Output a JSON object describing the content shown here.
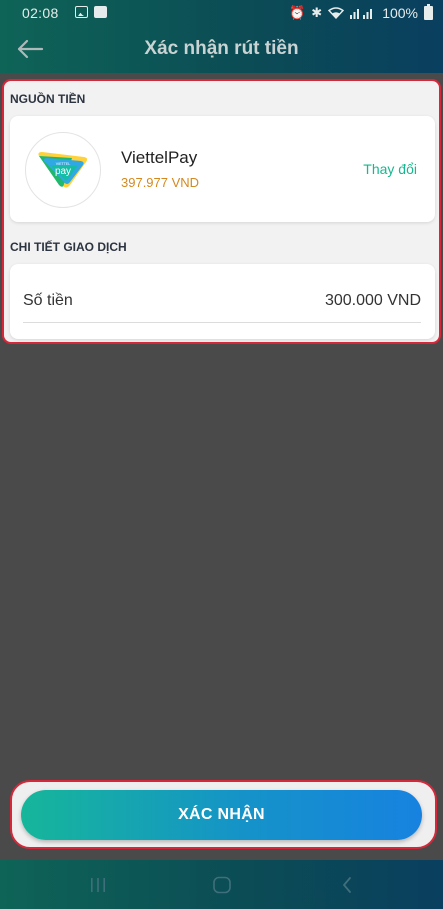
{
  "status_bar": {
    "time": "02:08",
    "battery": "100%",
    "icons": [
      "image-icon",
      "notification-icon",
      "alarm-icon",
      "bluetooth-icon",
      "wifi-icon",
      "signal-icon",
      "battery-icon"
    ]
  },
  "app_bar": {
    "back_icon": "arrow-left-icon",
    "title": "Xác nhận rút tiền"
  },
  "source_section": {
    "title": "NGUỒN TIỀN",
    "wallet_name": "ViettelPay",
    "balance": "397.977 VND",
    "change_label": "Thay đổi",
    "logo_icon": "viettelpay-logo-icon",
    "logo_text_small": "VIETTEL",
    "logo_text": "pay"
  },
  "detail_section": {
    "title": "CHI TIẾT GIAO DỊCH",
    "amount_label": "Số tiền",
    "amount_value": "300.000 VND"
  },
  "confirm_button": {
    "label": "XÁC NHẬN"
  },
  "nav_bar": {
    "items": [
      "recent-apps-icon",
      "home-icon",
      "back-icon"
    ]
  },
  "colors": {
    "header_gradient_start": "#0e6457",
    "header_gradient_end": "#0a3f5f",
    "highlight_border": "#d6283a",
    "balance_text": "#d4891f",
    "change_link": "#17b78f",
    "button_gradient_start": "#16b69a",
    "button_gradient_end": "#1782e0",
    "dim_background": "#4a4a4a"
  }
}
